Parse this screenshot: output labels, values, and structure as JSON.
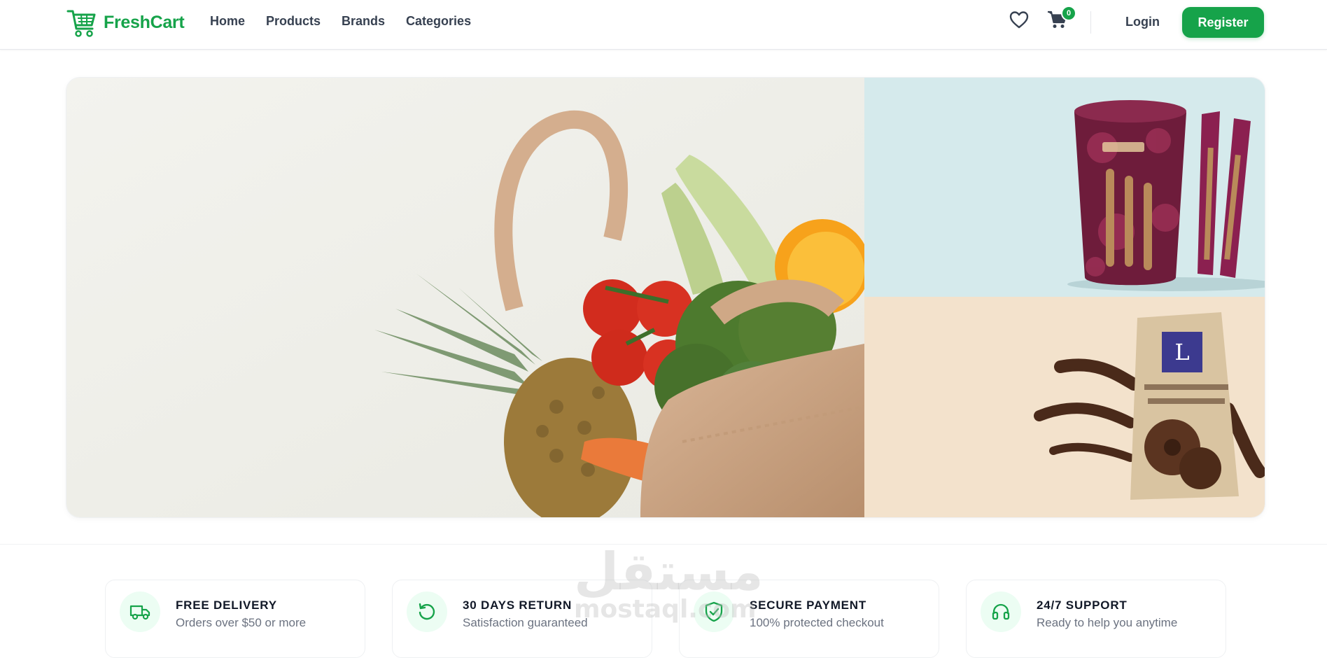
{
  "brand": {
    "name": "FreshCart",
    "logo_icon": "cart-logo-icon"
  },
  "nav": {
    "links": [
      "Home",
      "Products",
      "Brands",
      "Categories"
    ],
    "wishlist_icon": "heart-icon",
    "cart_icon": "cart-icon",
    "cart_count": "0",
    "login_label": "Login",
    "register_label": "Register"
  },
  "hero": {
    "main_image": "grocery-bag-vegetables",
    "side_top_image": "red-velvet-wafer-rolls",
    "side_bottom_image": "cokoladni-kolutici-bag"
  },
  "features": [
    {
      "icon": "truck-icon",
      "title": "FREE DELIVERY",
      "subtitle": "Orders over $50 or more"
    },
    {
      "icon": "return-icon",
      "title": "30 DAYS RETURN",
      "subtitle": "Satisfaction guaranteed"
    },
    {
      "icon": "shield-icon",
      "title": "SECURE PAYMENT",
      "subtitle": "100% protected checkout"
    },
    {
      "icon": "headset-icon",
      "title": "24/7 SUPPORT",
      "subtitle": "Ready to help you anytime"
    }
  ],
  "watermark": {
    "arabic": "مستقل",
    "latin": "mostaql.com"
  },
  "colors": {
    "primary": "#16a34a",
    "nav_text": "#374151",
    "muted": "#6b7280",
    "icon_bg": "#ecfdf3"
  }
}
